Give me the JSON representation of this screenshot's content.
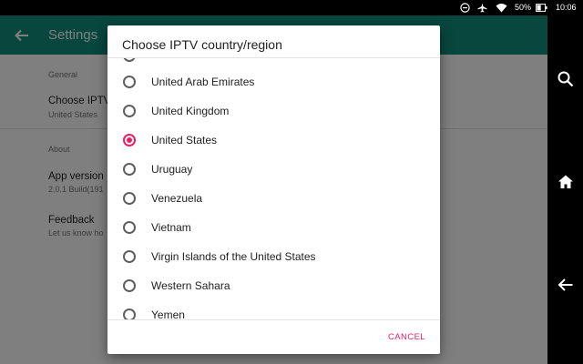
{
  "statusbar": {
    "battery": "50%",
    "time": "10:06"
  },
  "toolbar": {
    "title": "Settings"
  },
  "settings": {
    "general_header": "General",
    "choose_title": "Choose IPTV",
    "choose_value": "United States",
    "about_header": "About",
    "version_title": "App version",
    "version_value": "2.0.1 Build(191",
    "feedback_title": "Feedback",
    "feedback_sub": "Let us know ho"
  },
  "dialog": {
    "title": "Choose IPTV country/region",
    "options": [
      {
        "label": "United Arab Emirates",
        "selected": false
      },
      {
        "label": "United Kingdom",
        "selected": false
      },
      {
        "label": "United States",
        "selected": true
      },
      {
        "label": "Uruguay",
        "selected": false
      },
      {
        "label": "Venezuela",
        "selected": false
      },
      {
        "label": "Vietnam",
        "selected": false
      },
      {
        "label": "Virgin Islands of the United States",
        "selected": false
      },
      {
        "label": "Western Sahara",
        "selected": false
      },
      {
        "label": "Yemen",
        "selected": false
      }
    ],
    "cancel_label": "CANCEL"
  },
  "colors": {
    "toolbar": "#0f8f7d",
    "accent": "#e91e63"
  },
  "icons": [
    "dnd-icon",
    "airplane-icon",
    "wifi-icon",
    "battery-icon",
    "back-arrow-icon",
    "search-icon",
    "home-icon",
    "nav-back-icon"
  ]
}
